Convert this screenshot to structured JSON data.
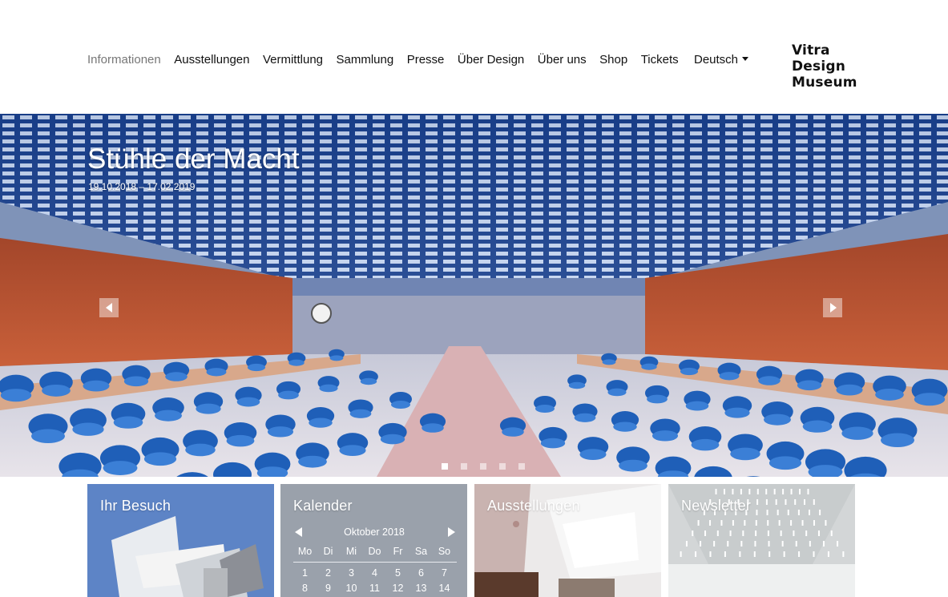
{
  "nav": {
    "items": [
      {
        "label": "Informationen",
        "active": true
      },
      {
        "label": "Ausstellungen"
      },
      {
        "label": "Vermittlung"
      },
      {
        "label": "Sammlung"
      },
      {
        "label": "Presse"
      },
      {
        "label": "Über Design"
      },
      {
        "label": "Über uns"
      },
      {
        "label": "Shop"
      },
      {
        "label": "Tickets"
      }
    ],
    "language": "Deutsch",
    "logo_lines": [
      "Vitra",
      "Design",
      "Museum"
    ]
  },
  "hero": {
    "title": "Stühle der Macht",
    "dates": "19.10.2018 – 17.02.2019",
    "slide_count": 5,
    "active_slide": 1
  },
  "tiles": {
    "visit": {
      "title": "Ihr Besuch"
    },
    "calendar": {
      "title": "Kalender",
      "month": "Oktober 2018",
      "weekdays": [
        "Mo",
        "Di",
        "Mi",
        "Do",
        "Fr",
        "Sa",
        "So"
      ],
      "week1": [
        "1",
        "2",
        "3",
        "4",
        "5",
        "6",
        "7"
      ],
      "week2": [
        "8",
        "9",
        "10",
        "11",
        "12",
        "13",
        "14"
      ]
    },
    "exhibitions": {
      "title": "Ausstellungen"
    },
    "newsletter": {
      "title": "Newsletter"
    }
  },
  "colors": {
    "nav_active": "#777777",
    "calendar_tile": "#9aa1ab",
    "visit_sky": "#5d84c6"
  }
}
